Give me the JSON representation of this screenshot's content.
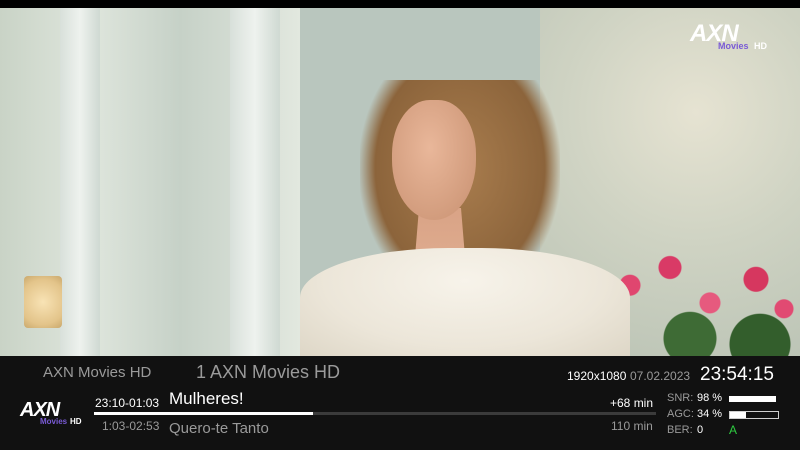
{
  "video": {
    "channel_logo": {
      "text": "AXN",
      "sub": "Movies",
      "hd": "HD"
    }
  },
  "infobar": {
    "channel_name": "AXN Movies HD",
    "channel_number_title": "1 AXN Movies HD",
    "resolution": "1920x1080",
    "date": "07.02.2023",
    "clock": "23:54:15",
    "logo": {
      "text": "AXN",
      "sub": "Movies",
      "hd": "HD"
    },
    "current": {
      "time": "23:10-01:03",
      "title": "Mulheres!",
      "remaining": "+68 min",
      "progress_fraction": 0.39
    },
    "next": {
      "time": "1:03-02:53",
      "title": "Quero-te Tanto",
      "duration": "110 min"
    },
    "signal": {
      "snr_label": "SNR:",
      "snr_value": "98 %",
      "snr_fraction": 0.98,
      "agc_label": "AGC:",
      "agc_value": "34 %",
      "agc_fraction": 0.34,
      "ber_label": "BER:",
      "ber_value": "0",
      "status": "A",
      "status_color": "#2ecc40"
    }
  }
}
